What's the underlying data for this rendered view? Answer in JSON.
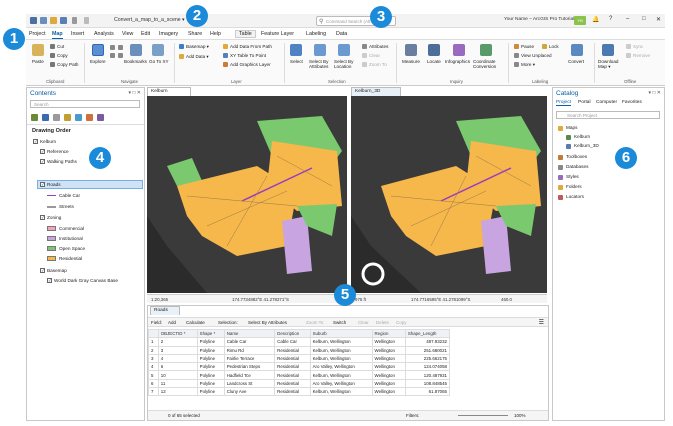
{
  "callouts": [
    "1",
    "2",
    "3",
    "4",
    "5",
    "6"
  ],
  "titlebar": {
    "doc_title": "Convert_a_map_to_a_scene ▾",
    "search_placeholder": "Command Search (Alt+Q)",
    "user_name": "Your Name – ArcGIS Pro Tutorials",
    "user_initials": "YN",
    "help": "?",
    "minimize": "–",
    "maximize": "□",
    "close": "✕"
  },
  "menu": {
    "items": [
      "Project",
      "Map",
      "Insert",
      "Analysis",
      "View",
      "Edit",
      "Imagery",
      "Share",
      "Help"
    ],
    "active": "Map",
    "context_tabs": [
      "Table",
      "Feature Layer",
      "Labeling",
      "Data"
    ]
  },
  "ribbon": {
    "clipboard": {
      "paste": "Paste",
      "cut": "Cut",
      "copy": "Copy",
      "copy_path": "Copy Path",
      "label": "Clipboard"
    },
    "navigate": {
      "explore": "Explore",
      "bookmarks": "Bookmarks",
      "go_to_xy": "Go To XY",
      "label": "Navigate"
    },
    "layer": {
      "basemap": "Basemap ▾",
      "add_data": "Add Data ▾",
      "add_from_path": "Add Data From Path",
      "xy_table": "XY Table To Point",
      "add_graphics": "Add Graphics Layer",
      "label": "Layer"
    },
    "selection": {
      "select": "Select",
      "by_attributes": "Select By Attributes",
      "by_location": "Select By Location",
      "attributes": "Attributes",
      "clear": "Clear",
      "zoom_to": "Zoom To",
      "label": "Selection"
    },
    "inquiry": {
      "measure": "Measure",
      "locate": "Locate",
      "infographics": "Infographics",
      "coordinate_conversion": "Coordinate Conversion",
      "label": "Inquiry"
    },
    "labeling": {
      "pause": "Pause",
      "lock": "Lock",
      "view_unplaced": "View Unplaced",
      "more": "More ▾",
      "label": "Labeling"
    },
    "convert": {
      "label_text": "Convert"
    },
    "offline": {
      "download_map": "Download Map ▾",
      "sync": "Sync",
      "remove": "Remove",
      "label": "Offline"
    }
  },
  "contents": {
    "title": "Contents",
    "search_placeholder": "Search",
    "drawing_order": "Drawing Order",
    "items": [
      {
        "label": "Kelburn",
        "level": 0
      },
      {
        "label": "Reference",
        "level": 1
      },
      {
        "label": "Walking Paths",
        "level": 1
      },
      {
        "label": "Roads",
        "level": 1,
        "selected": true
      },
      {
        "label": "Cable Car",
        "level": 2
      },
      {
        "label": "Streets",
        "level": 2
      },
      {
        "label": "Zoning",
        "level": 1
      },
      {
        "label": "Commercial",
        "level": 2,
        "color": "#f4a6b8"
      },
      {
        "label": "Institutional",
        "level": 2,
        "color": "#c8a4e0"
      },
      {
        "label": "Open Space",
        "level": 2,
        "color": "#7bc96f"
      },
      {
        "label": "Residential",
        "level": 2,
        "color": "#f6b74b"
      },
      {
        "label": "Basemap",
        "level": 1
      },
      {
        "label": "World Dark Gray Canvas Base",
        "level": 2
      }
    ]
  },
  "views": {
    "map_tab": "Kelburn",
    "scene_tab": "Kelburn_3D",
    "map_scale": "1:20,365",
    "map_coords": "174.7734882°E 41.278271°S",
    "scene_scale": "975 ft",
    "scene_coords": "174.7716595°E 41.2781099°S",
    "scene_elev": "460.0"
  },
  "table": {
    "tab": "Roads",
    "toolbar": [
      "Field:",
      "Add",
      "Calculate",
      "Selection:",
      "Select By Attributes",
      "Zoom To",
      "Switch",
      "Clear",
      "Delete",
      "Copy"
    ],
    "columns": [
      "",
      "OBJECTID *",
      "Shape *",
      "Name",
      "Description",
      "Suburb",
      "Region",
      "Shape_Length"
    ],
    "rows": [
      [
        "1",
        "2",
        "Polyline",
        "Cable Car",
        "Cable Car",
        "Kelburn, Wellington",
        "Wellington",
        "487.93232"
      ],
      [
        "2",
        "3",
        "Polyline",
        "Rimu Rd",
        "Residential",
        "Kelburn, Wellington",
        "Wellington",
        "251.680021"
      ],
      [
        "3",
        "4",
        "Polyline",
        "Fairlie Terrace",
        "Residential",
        "Kelburn, Wellington",
        "Wellington",
        "225.662175"
      ],
      [
        "4",
        "6",
        "Polyline",
        "Pedestrian Steps",
        "Residential",
        "Aro Valley, Wellington",
        "Wellington",
        "124.074058"
      ],
      [
        "5",
        "10",
        "Polyline",
        "Hadfield Tce",
        "Residential",
        "Kelburn, Wellington",
        "Wellington",
        "120.487931"
      ],
      [
        "6",
        "11",
        "Polyline",
        "Landcross St",
        "Residential",
        "Aro Valley, Wellington",
        "Wellington",
        "108.848545"
      ],
      [
        "7",
        "12",
        "Polyline",
        "Cluny Ave",
        "Residential",
        "Kelburn, Wellington",
        "Wellington",
        "61.87065"
      ]
    ],
    "status": "0 of 65 selected",
    "filters_label": "Filters:",
    "zoom": "100%"
  },
  "catalog": {
    "title": "Catalog",
    "tabs": [
      "Project",
      "Portal",
      "Computer",
      "Favorites"
    ],
    "search_placeholder": "Search Project",
    "items": [
      {
        "label": "Maps",
        "level": 0
      },
      {
        "label": "Kelburn",
        "level": 1
      },
      {
        "label": "Kelburn_3D",
        "level": 1
      },
      {
        "label": "Toolboxes",
        "level": 0
      },
      {
        "label": "Databases",
        "level": 0
      },
      {
        "label": "Styles",
        "level": 0
      },
      {
        "label": "Folders",
        "level": 0
      },
      {
        "label": "Locators",
        "level": 0
      }
    ]
  },
  "colors": {
    "residential": "#f6b74b",
    "open_space": "#7bc96f",
    "institutional": "#c8a4e0",
    "commercial": "#f4a6b8",
    "callout": "#1b8ad8",
    "accent": "#0a5ea8"
  }
}
